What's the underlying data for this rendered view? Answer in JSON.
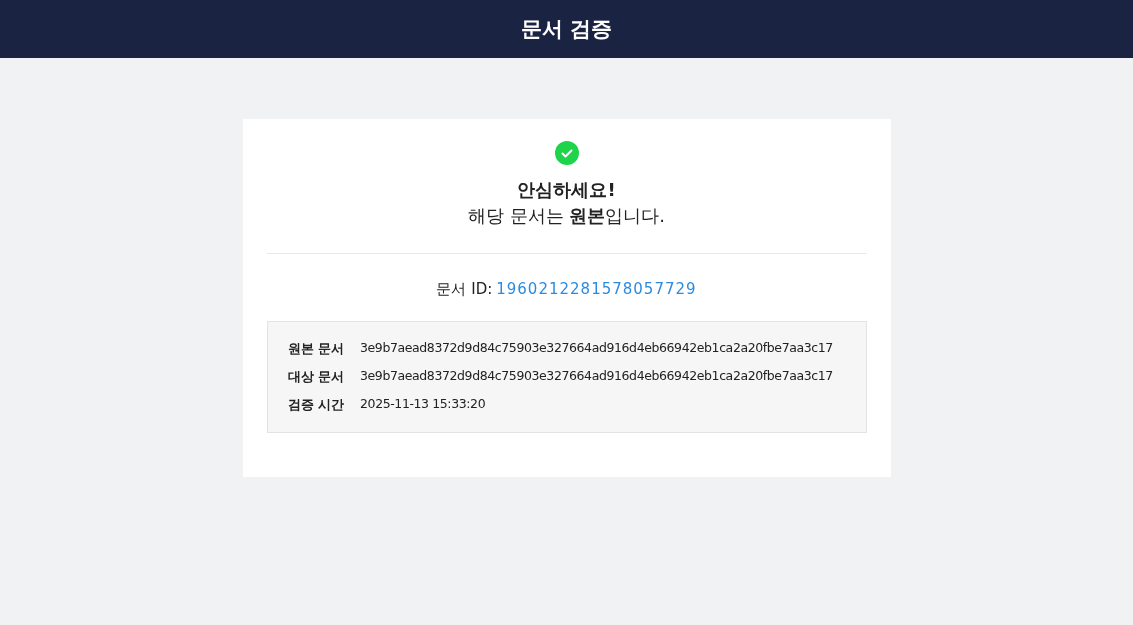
{
  "header": {
    "title": "문서 검증"
  },
  "result": {
    "verified": true,
    "headline": "안심하세요!",
    "message": "해당 문서는 **원본**입니다."
  },
  "document_id": {
    "label": "문서 ID:",
    "value": "1960212281578057729"
  },
  "details": [
    {
      "label": "원본 문서",
      "value": "3e9b7aead8372d9d84c75903e327664ad916d4eb66942eb1ca2a20fbe7aa3c17"
    },
    {
      "label": "대상 문서",
      "value": "3e9b7aead8372d9d84c75903e327664ad916d4eb66942eb1ca2a20fbe7aa3c17"
    },
    {
      "label": "검증 시간",
      "value": "2025-11-13 15:33:20"
    }
  ]
}
